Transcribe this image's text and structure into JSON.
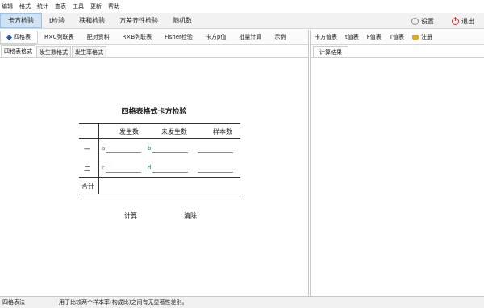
{
  "menubar": {
    "items": [
      "编辑",
      "格式",
      "统计",
      "查表",
      "工具",
      "更新",
      "帮助"
    ]
  },
  "main_tabs": [
    "卡方检验",
    "t检验",
    "秩和检验",
    "方差齐性检验",
    "随机数"
  ],
  "actions": {
    "settings": "设置",
    "exit": "退出"
  },
  "test_types": [
    "四格表",
    "R×C列联表",
    "配对资料",
    "R×B列联表",
    "Fisher检验",
    "卡方p值",
    "批量计算",
    "示例"
  ],
  "sub_tabs": [
    "四格表格式",
    "发生数格式",
    "发生率格式"
  ],
  "form": {
    "title": "四格表格式卡方检验",
    "col_headers": [
      "发生数",
      "未发生数",
      "样本数"
    ],
    "row_labels": [
      "一",
      "二",
      "合计"
    ],
    "cell_labels": [
      "a",
      "b",
      "c",
      "d"
    ],
    "calc_button": "计算",
    "clear_button": "清除"
  },
  "right_tools": [
    "卡方值表",
    "t值表",
    "F值表",
    "T值表",
    "注册"
  ],
  "right_tab": "计算结果",
  "status": {
    "left": "四格表法",
    "message": "用于比较两个样本率(构成比)之间有无显著性差别。"
  }
}
